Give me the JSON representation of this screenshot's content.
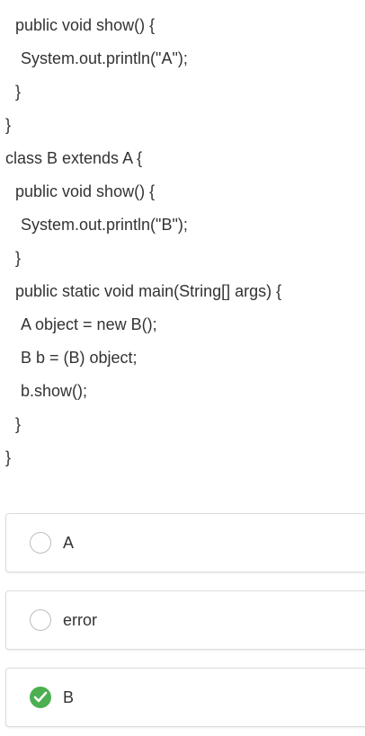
{
  "code": {
    "lines": [
      "public void show() {",
      "System.out.println(\"A\");",
      "}",
      "}",
      "class B extends A {",
      "public void show() {",
      "System.out.println(\"B\");",
      "}",
      "public static void main(String[] args) {",
      "A object = new B();",
      "B b = (B) object;",
      "b.show();",
      "}",
      "}"
    ]
  },
  "options": [
    {
      "label": "A",
      "selected": false,
      "icon": "radio-empty-icon"
    },
    {
      "label": "error",
      "selected": false,
      "icon": "radio-empty-icon"
    },
    {
      "label": "B",
      "selected": true,
      "icon": "check-circle-icon"
    }
  ],
  "colors": {
    "text": "#333333",
    "selected": "#4caf50",
    "border": "#dcdcdc"
  }
}
